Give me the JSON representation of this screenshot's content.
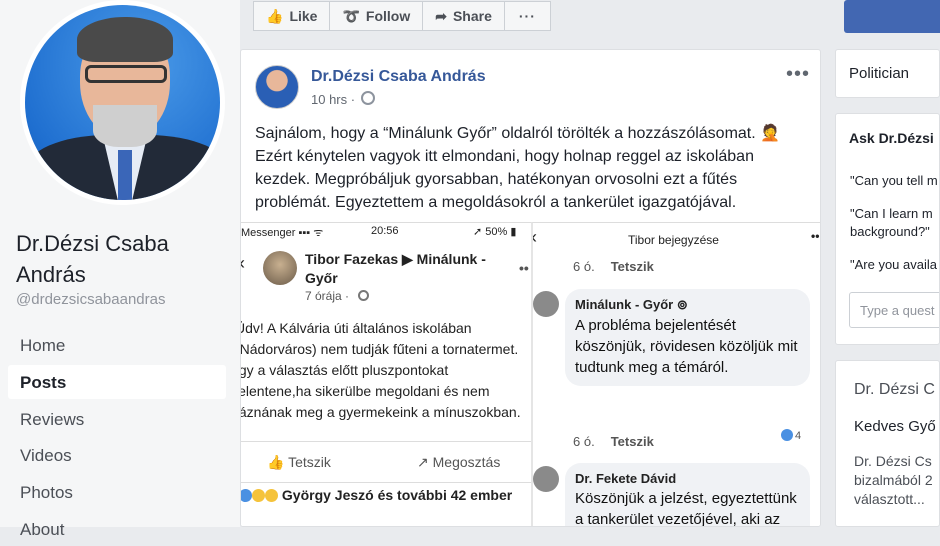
{
  "sidebar": {
    "page_name": "Dr.Dézsi Csaba András",
    "handle": "@drdezsicsabaandras",
    "nav": [
      "Home",
      "Posts",
      "Reviews",
      "Videos",
      "Photos",
      "About"
    ]
  },
  "actions": {
    "like": "Like",
    "follow": "Follow",
    "share": "Share",
    "more": "···"
  },
  "post": {
    "author": "Dr.Dézsi Csaba András",
    "time": "10 hrs · ",
    "more": "•••",
    "text": "Sajnálom, hogy a “Minálunk Győr” oldalról törölték a hozzászólásomat. 🤦 Ezért kénytelen vagyok itt elmondani, hogy holnap reggel az iskolában kezdek. Megpróbáljuk gyorsabban, hatékonyan orvosolni ezt a fűtés problémát. Egyeztettem a megoldásokról a tankerület igazgatójával."
  },
  "shot_left": {
    "status_carrier": "Messenger ▪▪▪ ᯤ",
    "status_time": "20:56",
    "status_battery": "➚ 50% ▮",
    "back": "‹",
    "header": "Tibor Fazekas ▶ Minálunk - Győr",
    "time": "7 órája · ",
    "dots": "••",
    "body": "Üdv! A Kálvária úti általános iskolában (Nádorváros) nem tudják fűteni a tornatermet. Így a választás előtt pluszpontokat jelentene,ha sikerülbe megoldani és nem fáznának meg a gyermekeink a mínuszokban.",
    "like": "👍 Tetszik",
    "share": "↗ Megosztás",
    "reactions": "György Jeszó és további 42 ember"
  },
  "shot_right": {
    "back": "‹",
    "title": "Tibor bejegyzése",
    "dots": "••",
    "top_meta_time": "6 ó.",
    "top_meta_like": "Tetszik",
    "comments": [
      {
        "author": "Minálunk - Győr ⊚",
        "text": "A probléma bejelentését köszönjük, rövidesen közöljük mit tudtunk meg a témáról.",
        "time": "6 ó.",
        "like": "Tetszik",
        "likes": "4"
      },
      {
        "author": "Dr. Fekete Dávid",
        "text": "Köszönjük a jelzést, egyeztettünk a tankerület vezetőjével, aki az alábbi tájékoztatást adta: leszerződtek"
      }
    ]
  },
  "right_col": {
    "category": "Politician",
    "ask_title": "Ask Dr.Dézsi",
    "questions": [
      "\"Can you tell m",
      "\"Can I learn m",
      "background?\"",
      "\"Are you availa"
    ],
    "ask_placeholder": "Type a quest",
    "pinned_name": "Dr. Dézsi C",
    "pinned_lines": [
      "Kedves Győ",
      "Dr. Dézsi Cs",
      "bizalmából 2",
      "választott..."
    ]
  },
  "colors": {
    "fb_blue": "#4267b2",
    "link": "#365899",
    "bg": "#e9ebee"
  }
}
